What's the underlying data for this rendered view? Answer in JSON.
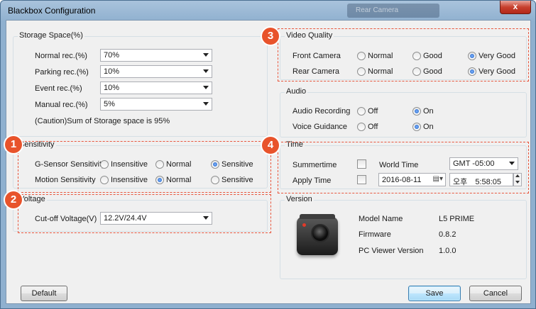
{
  "window": {
    "title": "Blackbox Configuration",
    "background_tab": "Rear Camera",
    "close_glyph": "x"
  },
  "storage": {
    "group_label": "Storage Space(%)",
    "rows": [
      {
        "label": "Normal rec.(%)",
        "value": "70%"
      },
      {
        "label": "Parking rec.(%)",
        "value": "10%"
      },
      {
        "label": "Event rec.(%)",
        "value": "10%"
      },
      {
        "label": "Manual rec.(%)",
        "value": "5%"
      }
    ],
    "caution": "(Caution)Sum of Storage space is 95%"
  },
  "sensitivity": {
    "group_label": "Sensitivity",
    "badge": "1",
    "options": [
      "Insensitive",
      "Normal",
      "Sensitive"
    ],
    "rows": [
      {
        "label": "G-Sensor Sensitivity",
        "selected": "Sensitive"
      },
      {
        "label": "Motion Sensitivity",
        "selected": "Normal"
      }
    ]
  },
  "voltage": {
    "group_label": "Voltage",
    "badge": "2",
    "label": "Cut-off Voltage(V)",
    "value": "12.2V/24.4V"
  },
  "video_quality": {
    "group_label": "Video Quality",
    "badge": "3",
    "options": [
      "Normal",
      "Good",
      "Very Good"
    ],
    "rows": [
      {
        "label": "Front Camera",
        "selected": "Very Good"
      },
      {
        "label": "Rear Camera",
        "selected": "Very Good"
      }
    ]
  },
  "audio": {
    "group_label": "Audio",
    "options": [
      "Off",
      "On"
    ],
    "rows": [
      {
        "label": "Audio Recording",
        "selected": "On"
      },
      {
        "label": "Voice Guidance",
        "selected": "On"
      }
    ]
  },
  "time": {
    "group_label": "Time",
    "badge": "4",
    "summertime_label": "Summertime",
    "summertime_checked": false,
    "world_time_label": "World Time",
    "world_time_value": "GMT -05:00",
    "apply_time_label": "Apply Time",
    "apply_time_checked": false,
    "date_value": "2016-08-11",
    "ampm": "오후",
    "time_value": "5:58:05"
  },
  "version": {
    "group_label": "Version",
    "rows": [
      {
        "label": "Model Name",
        "value": "L5 PRIME"
      },
      {
        "label": "Firmware",
        "value": "0.8.2"
      },
      {
        "label": "PC Viewer Version",
        "value": "1.0.0"
      }
    ]
  },
  "buttons": {
    "default": "Default",
    "save": "Save",
    "cancel": "Cancel"
  },
  "colors": {
    "annotation": "#e8532b",
    "dashed": "#e8563d"
  }
}
